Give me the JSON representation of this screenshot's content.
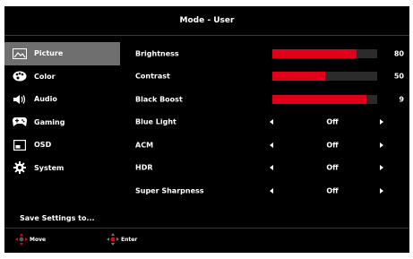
{
  "header": {
    "title": "Mode - User"
  },
  "menu": {
    "items": [
      {
        "label": "Picture",
        "icon": "picture-icon",
        "active": true
      },
      {
        "label": "Color",
        "icon": "palette-icon"
      },
      {
        "label": "Audio",
        "icon": "speaker-icon"
      },
      {
        "label": "Gaming",
        "icon": "gamepad-icon"
      },
      {
        "label": "OSD",
        "icon": "osd-window-icon"
      },
      {
        "label": "System",
        "icon": "gear-icon"
      }
    ],
    "save_label": "Save Settings to..."
  },
  "settings": {
    "brightness": {
      "label": "Brightness",
      "value": "80",
      "level": 0.8
    },
    "contrast": {
      "label": "Contrast",
      "value": "50",
      "level": 0.5
    },
    "black_boost": {
      "label": "Black Boost",
      "value": "9",
      "level": 0.9
    },
    "blue_light": {
      "label": "Blue Light",
      "value": "Off"
    },
    "acm": {
      "label": "ACM",
      "value": "Off"
    },
    "hdr": {
      "label": "HDR",
      "value": "Off"
    },
    "super_sharpness": {
      "label": "Super Sharpness",
      "value": "Off"
    }
  },
  "footer": {
    "move_label": "Move",
    "enter_label": "Enter"
  },
  "colors": {
    "accent": "#e0001a",
    "background": "#000000",
    "active_item": "#6f6f6f"
  }
}
